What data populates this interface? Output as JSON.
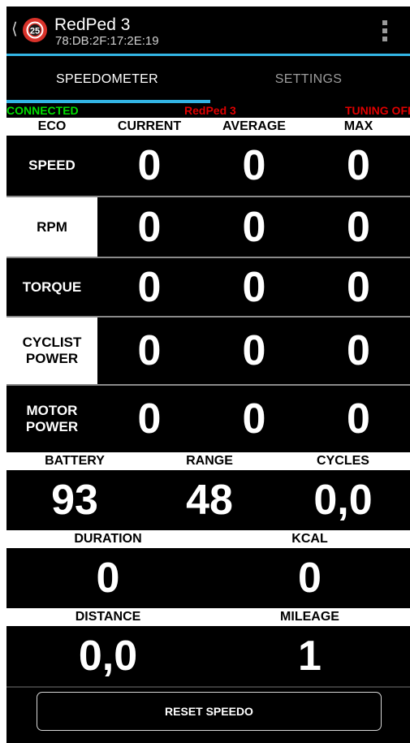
{
  "header": {
    "title": "RedPed 3",
    "subtitle": "78:DB:2F:17:2E:19",
    "logo_text": "25",
    "back_icon": "chevron-left-icon",
    "menu_icon": "overflow-menu-icon"
  },
  "tabs": [
    {
      "label": "SPEEDOMETER",
      "active": true
    },
    {
      "label": "SETTINGS",
      "active": false
    }
  ],
  "status": {
    "connection": "CONNECTED",
    "device": "RedPed 3",
    "tuning": "TUNING OFF"
  },
  "columns": [
    "ECO",
    "CURRENT",
    "AVERAGE",
    "MAX"
  ],
  "metrics": [
    {
      "label": "SPEED",
      "current": "0",
      "average": "0",
      "max": "0"
    },
    {
      "label": "RPM",
      "current": "0",
      "average": "0",
      "max": "0"
    },
    {
      "label": "TORQUE",
      "current": "0",
      "average": "0",
      "max": "0"
    },
    {
      "label": "CYCLIST\nPOWER",
      "current": "0",
      "average": "0",
      "max": "0"
    },
    {
      "label": "MOTOR\nPOWER",
      "current": "0",
      "average": "0",
      "max": "0"
    }
  ],
  "battery_section": {
    "labels": [
      "BATTERY",
      "RANGE",
      "CYCLES"
    ],
    "values": [
      "93",
      "48",
      "0,0"
    ]
  },
  "duration_section": {
    "labels": [
      "DURATION",
      "KCAL"
    ],
    "values": [
      "0",
      "0"
    ]
  },
  "distance_section": {
    "labels": [
      "DISTANCE",
      "MILEAGE"
    ],
    "values": [
      "0,0",
      "1"
    ]
  },
  "reset_label": "RESET SPEEDO",
  "colors": {
    "accent": "#33b5e5",
    "connected": "#00e000",
    "alert": "#e00000"
  }
}
